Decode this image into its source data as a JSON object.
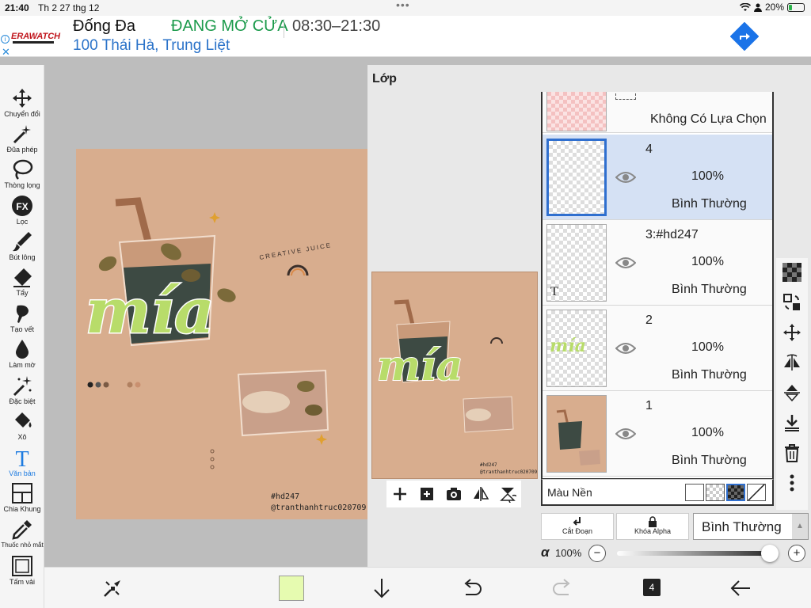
{
  "statusbar": {
    "time": "21:40",
    "date": "Th 2 27 thg 12",
    "battery": "20%",
    "battery_level": 0.2
  },
  "ad": {
    "brand": "ERAWATCH",
    "name": "Đống Đa",
    "status": "ĐANG MỞ CỬA",
    "hours": "08:30–21:30",
    "address": "100 Thái Hà, Trung Liệt",
    "icons": [
      "ad-info-icon",
      "ad-close-icon",
      "directions-icon"
    ]
  },
  "tools": [
    {
      "label": "Chuyển đổi",
      "icon": "move-icon"
    },
    {
      "label": "Đũa phép",
      "icon": "magic-wand-icon"
    },
    {
      "label": "Thòng lọng",
      "icon": "lasso-icon"
    },
    {
      "label": "Lọc",
      "icon": "fx-filter-icon"
    },
    {
      "label": "Bút lông",
      "icon": "brush-icon"
    },
    {
      "label": "Tẩy",
      "icon": "eraser-icon"
    },
    {
      "label": "Tạo vết",
      "icon": "smudge-icon"
    },
    {
      "label": "Làm mờ",
      "icon": "blur-drop-icon"
    },
    {
      "label": "Đặc biệt",
      "icon": "special-sparkle-icon"
    },
    {
      "label": "Xô",
      "icon": "bucket-icon"
    },
    {
      "label": "Văn bản",
      "icon": "text-tool-icon",
      "active": true
    },
    {
      "label": "Chia Khung",
      "icon": "frame-divider-icon"
    },
    {
      "label": "Thuốc nhỏ mắt",
      "icon": "eyedropper-icon"
    },
    {
      "label": "Tấm vải",
      "icon": "canvas-icon"
    }
  ],
  "canvas": {
    "art_text": "mía",
    "art_words": "CREATIVE JUICE",
    "tag": "#hd247",
    "handle": "@tranthanhtruc020709"
  },
  "layer_panel": {
    "title": "Lớp",
    "selection_row": "Không Có Lựa Chọn",
    "layers": [
      {
        "name": "4",
        "opacity": "100%",
        "mode": "Bình Thường",
        "selected": true
      },
      {
        "name": "3:#hd247",
        "opacity": "100%",
        "mode": "Bình Thường",
        "selected": false
      },
      {
        "name": "2",
        "opacity": "100%",
        "mode": "Bình Thường",
        "selected": false
      },
      {
        "name": "1",
        "opacity": "100%",
        "mode": "Bình Thường",
        "selected": false
      }
    ],
    "background_label": "Màu Nền",
    "clip_label": "Cắt Đoạn",
    "alpha_lock_label": "Khóa Alpha",
    "blend_mode": "Bình Thường",
    "alpha_symbol": "α",
    "alpha_value": "100%",
    "alpha_level": 1.0,
    "text_layer_glyph": "T",
    "minus": "−",
    "plus": "+"
  },
  "bottombar": {
    "layer_count": "4",
    "color": "#e6fbb0"
  },
  "colors": {
    "accent": "#1d7be0",
    "selected_layer": "#d5e1f4",
    "art_bg": "#d8ad8e",
    "text_fill": "#b8dc6a"
  }
}
